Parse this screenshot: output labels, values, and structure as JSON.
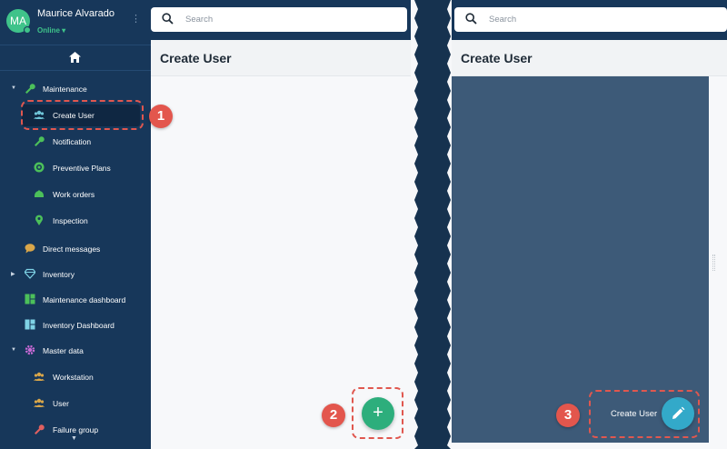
{
  "profile": {
    "initials": "MA",
    "name": "Maurice Alvarado",
    "status": "Online ▾"
  },
  "sidebar": {
    "items": [
      {
        "label": "Maintenance",
        "icon": "wrench-icon"
      },
      {
        "label": "Create User",
        "icon": "users-icon"
      },
      {
        "label": "Notification",
        "icon": "wrench-icon"
      },
      {
        "label": "Preventive Plans",
        "icon": "target-icon"
      },
      {
        "label": "Work orders",
        "icon": "helmet-icon"
      },
      {
        "label": "Inspection",
        "icon": "location-pin-icon"
      },
      {
        "label": "Direct messages",
        "icon": "chat-icon"
      },
      {
        "label": "Inventory",
        "icon": "diamond-icon"
      },
      {
        "label": "Maintenance dashboard",
        "icon": "grid-icon"
      },
      {
        "label": "Inventory Dashboard",
        "icon": "grid-icon"
      },
      {
        "label": "Master data",
        "icon": "gear-icon"
      },
      {
        "label": "Workstation",
        "icon": "users-icon"
      },
      {
        "label": "User",
        "icon": "users-icon"
      },
      {
        "label": "Failure group",
        "icon": "wrench-icon"
      }
    ]
  },
  "search": {
    "placeholder": "Search"
  },
  "left_panel": {
    "title": "Create User",
    "fab_symbol": "+"
  },
  "right_panel": {
    "title": "Create User",
    "fab_label": "Create User"
  },
  "callouts": [
    "1",
    "2",
    "3"
  ],
  "colors": {
    "sidebar": "#17375a",
    "accent_green": "#2dae7c",
    "accent_teal": "#33a9c9",
    "callout_red": "#e3564d",
    "status_online": "#3fc38a"
  }
}
